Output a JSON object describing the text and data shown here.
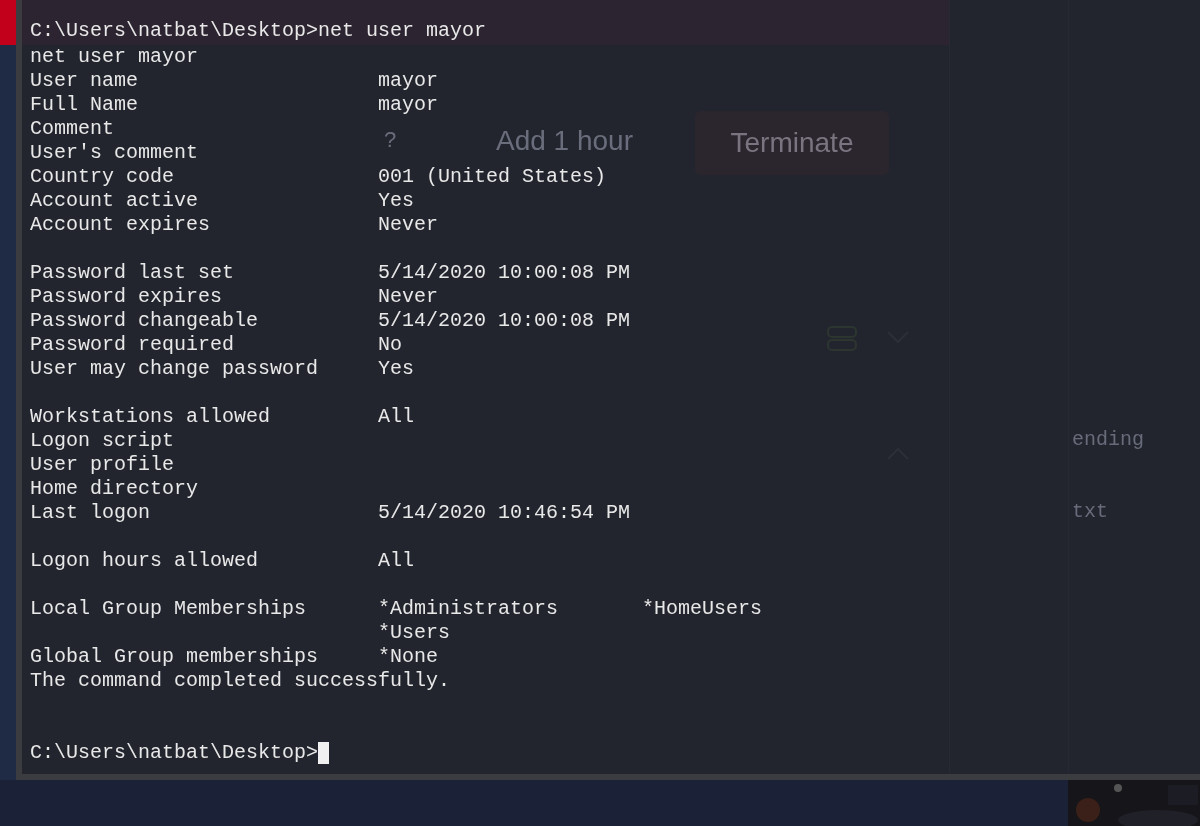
{
  "background_app": {
    "help_mark": "?",
    "add_hour": "Add 1 hour",
    "terminate_button": "Terminate",
    "partial_texts": [
      "ending",
      "txt"
    ]
  },
  "terminal": {
    "lines": [
      {
        "kind": "prompt",
        "path": "C:\\Users\\natbat\\Desktop>",
        "command": "net user mayor",
        "highlighted": true,
        "cursor": false
      },
      {
        "kind": "text",
        "text": "net user mayor"
      },
      {
        "kind": "field",
        "label": "User name",
        "values": [
          "mayor"
        ]
      },
      {
        "kind": "field",
        "label": "Full Name",
        "values": [
          "mayor"
        ]
      },
      {
        "kind": "field",
        "label": "Comment"
      },
      {
        "kind": "field",
        "label": "User's comment"
      },
      {
        "kind": "field",
        "label": "Country code",
        "values": [
          "001 (United States)"
        ]
      },
      {
        "kind": "field",
        "label": "Account active",
        "values": [
          "Yes"
        ]
      },
      {
        "kind": "field",
        "label": "Account expires",
        "values": [
          "Never"
        ]
      },
      {
        "kind": "blank"
      },
      {
        "kind": "field",
        "label": "Password last set",
        "values": [
          "5/14/2020 10:00:08 PM"
        ]
      },
      {
        "kind": "field",
        "label": "Password expires",
        "values": [
          "Never"
        ]
      },
      {
        "kind": "field",
        "label": "Password changeable",
        "values": [
          "5/14/2020 10:00:08 PM"
        ]
      },
      {
        "kind": "field",
        "label": "Password required",
        "values": [
          "No"
        ]
      },
      {
        "kind": "field",
        "label": "User may change password",
        "values": [
          "Yes"
        ]
      },
      {
        "kind": "blank"
      },
      {
        "kind": "field",
        "label": "Workstations allowed",
        "values": [
          "All"
        ]
      },
      {
        "kind": "field",
        "label": "Logon script"
      },
      {
        "kind": "field",
        "label": "User profile"
      },
      {
        "kind": "field",
        "label": "Home directory"
      },
      {
        "kind": "field",
        "label": "Last logon",
        "values": [
          "5/14/2020 10:46:54 PM"
        ]
      },
      {
        "kind": "blank"
      },
      {
        "kind": "field",
        "label": "Logon hours allowed",
        "values": [
          "All"
        ]
      },
      {
        "kind": "blank"
      },
      {
        "kind": "field",
        "label": "Local Group Memberships",
        "values": [
          "*Administrators",
          "*HomeUsers"
        ]
      },
      {
        "kind": "field",
        "values": [
          "*Users"
        ]
      },
      {
        "kind": "field",
        "label": "Global Group memberships",
        "values": [
          "*None"
        ]
      },
      {
        "kind": "text",
        "text": "The command completed successfully."
      },
      {
        "kind": "blank"
      },
      {
        "kind": "blank"
      },
      {
        "kind": "prompt",
        "path": "C:\\Users\\natbat\\Desktop>",
        "highlighted": false,
        "cursor": true
      }
    ]
  }
}
